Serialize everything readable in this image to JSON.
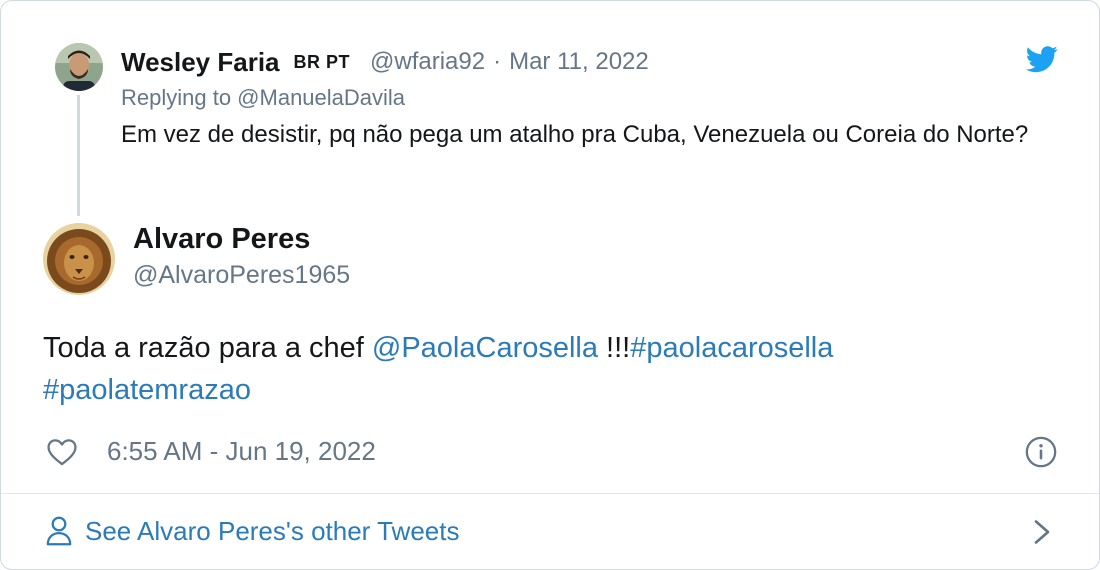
{
  "parent_tweet": {
    "name": "Wesley Faria",
    "flags": "BR PT",
    "handle": "@wfaria92",
    "separator": "·",
    "date": "Mar 11, 2022",
    "replying_to": "Replying to @ManuelaDavila",
    "text": "Em vez de desistir, pq não pega um atalho pra Cuba, Venezuela ou Coreia do Norte?"
  },
  "main_tweet": {
    "name": "Alvaro Peres",
    "handle": "@AlvaroPeres1965",
    "text_prefix": "Toda a razão para a chef ",
    "mention": "@PaolaCarosella",
    "text_mid": " !!!",
    "hashtag1": "#paolacarosella",
    "hashtag2": "#paolatemrazao",
    "timestamp": "6:55 AM - Jun 19, 2022"
  },
  "footer": {
    "label": "See Alvaro Peres's other Tweets"
  },
  "colors": {
    "link": "#2b7bb9",
    "muted": "#657786",
    "twitter_blue": "#1da1f2",
    "border": "#cfd9de"
  },
  "icons": {
    "brand": "twitter-bird-icon",
    "like": "heart-icon",
    "info": "info-icon",
    "profile": "person-icon",
    "next": "chevron-right-icon"
  }
}
